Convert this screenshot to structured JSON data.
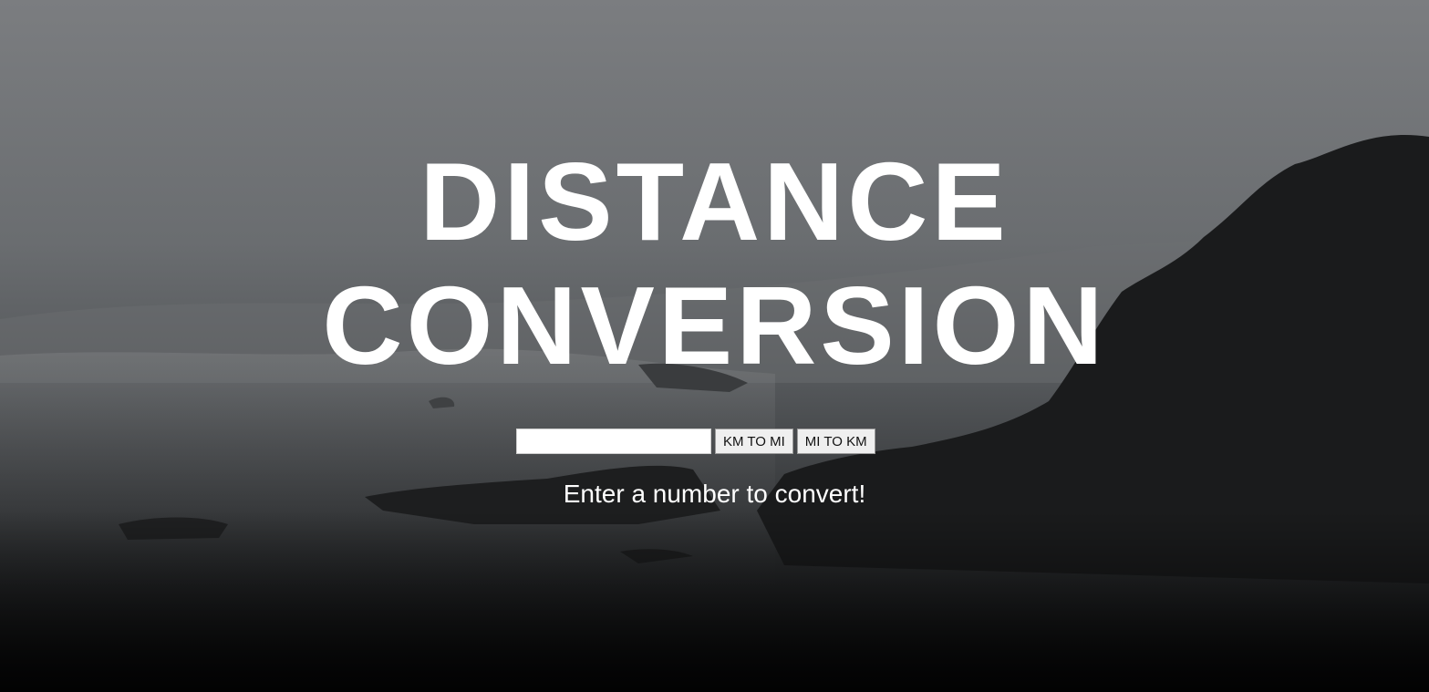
{
  "header": {
    "title_line1": "DISTANCE",
    "title_line2": "CONVERSION"
  },
  "converter": {
    "input_value": "",
    "km_to_mi_label": "KM TO MI",
    "mi_to_km_label": "MI TO KM",
    "result_message": "Enter a number to convert!"
  },
  "colors": {
    "title": "#ffffff",
    "button_background": "#efefef"
  }
}
